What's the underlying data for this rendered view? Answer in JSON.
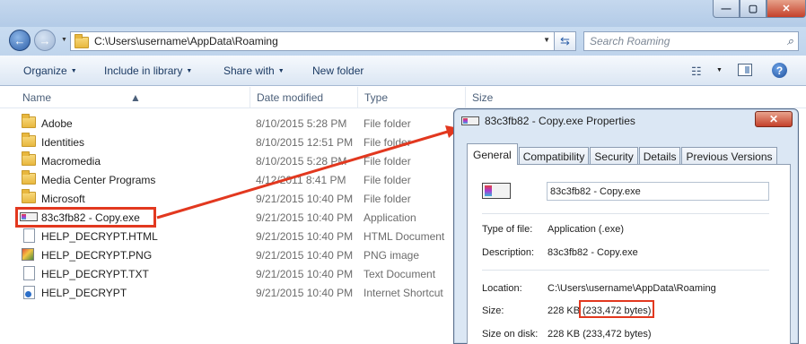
{
  "explorer": {
    "window_controls": {
      "minimize": "—",
      "maximize": "▢",
      "close": "✕"
    },
    "address": "C:\\Users\\username\\AppData\\Roaming",
    "search_placeholder": "Search Roaming",
    "toolbar": {
      "organize": "Organize",
      "include_in_library": "Include in library",
      "share_with": "Share with",
      "new_folder": "New folder"
    },
    "columns": {
      "name": "Name",
      "date_modified": "Date modified",
      "type": "Type",
      "size": "Size"
    },
    "files": [
      {
        "name": "Adobe",
        "date": "8/10/2015 5:28 PM",
        "type": "File folder",
        "icon": "folder-icon"
      },
      {
        "name": "Identities",
        "date": "8/10/2015 12:51 PM",
        "type": "File folder",
        "icon": "folder-icon"
      },
      {
        "name": "Macromedia",
        "date": "8/10/2015 5:28 PM",
        "type": "File folder",
        "icon": "folder-icon"
      },
      {
        "name": "Media Center Programs",
        "date": "4/12/2011 8:41 PM",
        "type": "File folder",
        "icon": "folder-icon"
      },
      {
        "name": "Microsoft",
        "date": "9/21/2015 10:40 PM",
        "type": "File folder",
        "icon": "folder-icon"
      },
      {
        "name": "83c3fb82 - Copy.exe",
        "date": "9/21/2015 10:40 PM",
        "type": "Application",
        "icon": "exe-icon"
      },
      {
        "name": "HELP_DECRYPT.HTML",
        "date": "9/21/2015 10:40 PM",
        "type": "HTML Document",
        "icon": "document-icon"
      },
      {
        "name": "HELP_DECRYPT.PNG",
        "date": "9/21/2015 10:40 PM",
        "type": "PNG image",
        "icon": "image-icon"
      },
      {
        "name": "HELP_DECRYPT.TXT",
        "date": "9/21/2015 10:40 PM",
        "type": "Text Document",
        "icon": "document-icon"
      },
      {
        "name": "HELP_DECRYPT",
        "date": "9/21/2015 10:40 PM",
        "type": "Internet Shortcut",
        "icon": "shortcut-icon"
      }
    ]
  },
  "properties": {
    "title": "83c3fb82 - Copy.exe Properties",
    "close": "✕",
    "tabs": [
      "General",
      "Compatibility",
      "Security",
      "Details",
      "Previous Versions"
    ],
    "active_tab": "General",
    "file_name": "83c3fb82 - Copy.exe",
    "type_of_file_label": "Type of file:",
    "type_of_file": "Application (.exe)",
    "description_label": "Description:",
    "description": "83c3fb82 - Copy.exe",
    "location_label": "Location:",
    "location": "C:\\Users\\username\\AppData\\Roaming",
    "size_label": "Size:",
    "size_kb": "228 KB",
    "size_bytes": "(233,472 bytes)",
    "size_on_disk_label": "Size on disk:",
    "size_on_disk": "228 KB (233,472 bytes)"
  },
  "colors": {
    "highlight": "#e2381f",
    "arrow": "#e2381f",
    "chrome": "#c5d8ee"
  }
}
